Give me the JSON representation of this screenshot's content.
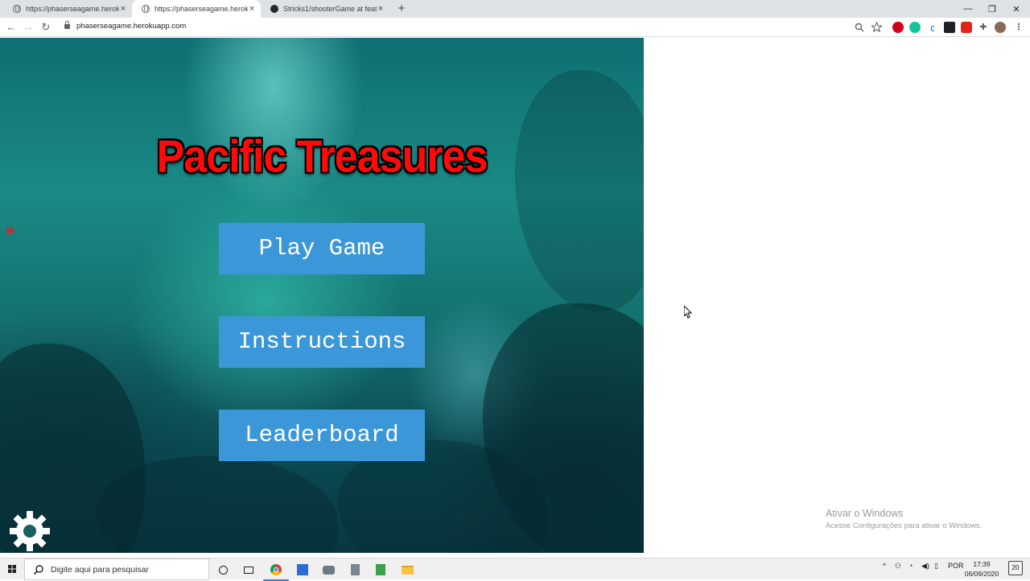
{
  "browser": {
    "tabs": [
      {
        "title": "https://phaserseagame.herokuapp",
        "favicon": "globe-icon",
        "active": false
      },
      {
        "title": "https://phaserseagame.herokuapp",
        "favicon": "globe-icon",
        "active": true
      },
      {
        "title": "Stricks1/shooterGame at feature",
        "favicon": "github-icon",
        "active": false
      }
    ],
    "new_tab_label": "+",
    "address": "phaserseagame.herokuapp.com",
    "window_controls": {
      "minimize": "—",
      "restore": "❐",
      "close": "✕"
    },
    "nav": {
      "back": "←",
      "forward": "→",
      "reload": "↻"
    }
  },
  "game": {
    "title": "Pacific Treasures",
    "buttons": [
      {
        "label": "Play Game"
      },
      {
        "label": "Instructions"
      },
      {
        "label": "Leaderboard"
      }
    ],
    "button_color": "#3c97d8",
    "title_color": "#ff0a0a"
  },
  "watermark": {
    "line1": "Ativar o Windows",
    "line2": "Acesse Configurações para ativar o Windows."
  },
  "taskbar": {
    "search_placeholder": "Digite aqui para pesquisar",
    "language": "POR",
    "time": "17:39",
    "date": "06/09/2020",
    "notifications": "20"
  }
}
